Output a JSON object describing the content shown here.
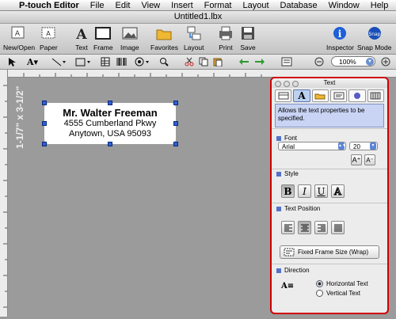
{
  "menubar": {
    "app": "P-touch Editor",
    "items": [
      "File",
      "Edit",
      "View",
      "Insert",
      "Format",
      "Layout",
      "Database",
      "Window",
      "Help"
    ]
  },
  "window": {
    "title": "Untitled1.lbx"
  },
  "toolbar": {
    "left": [
      {
        "label": "New/Open",
        "icon": "new-open-icon"
      },
      {
        "label": "Paper",
        "icon": "paper-icon"
      },
      {
        "label": "Text",
        "icon": "text-icon"
      },
      {
        "label": "Frame",
        "icon": "frame-icon"
      },
      {
        "label": "Image",
        "icon": "image-icon"
      },
      {
        "label": "Favorites",
        "icon": "favorites-icon"
      },
      {
        "label": "Layout",
        "icon": "layout-icon"
      },
      {
        "label": "Print",
        "icon": "print-icon"
      },
      {
        "label": "Save",
        "icon": "save-icon"
      }
    ],
    "right": [
      {
        "label": "Inspector",
        "icon": "inspector-icon"
      },
      {
        "label": "Snap Mode",
        "icon": "snap-mode-icon"
      }
    ]
  },
  "formatbar": {
    "zoom": "100%"
  },
  "canvas": {
    "size_label": "1-1/7\" x 3-1/2\""
  },
  "label": {
    "line1": "Mr. Walter Freeman",
    "line2": "4555 Cumberland Pkwy",
    "line3": "Anytown, USA 95093"
  },
  "inspector": {
    "title": "Text",
    "description": "Allows the text properties to be specified.",
    "font": {
      "heading": "Font",
      "family": "Arial",
      "size": "20"
    },
    "style": {
      "heading": "Style",
      "buttons": [
        "B",
        "I",
        "U",
        "A"
      ]
    },
    "text_position": {
      "heading": "Text Position",
      "wrap_label": "Fixed Frame Size (Wrap)"
    },
    "direction": {
      "heading": "Direction",
      "options": [
        "Horizontal Text",
        "Vertical Text"
      ],
      "selected": "Horizontal Text"
    }
  },
  "colors": {
    "highlight": "#d10000",
    "selection": "#2f5fd0",
    "description_bg": "#c9d4f4"
  }
}
